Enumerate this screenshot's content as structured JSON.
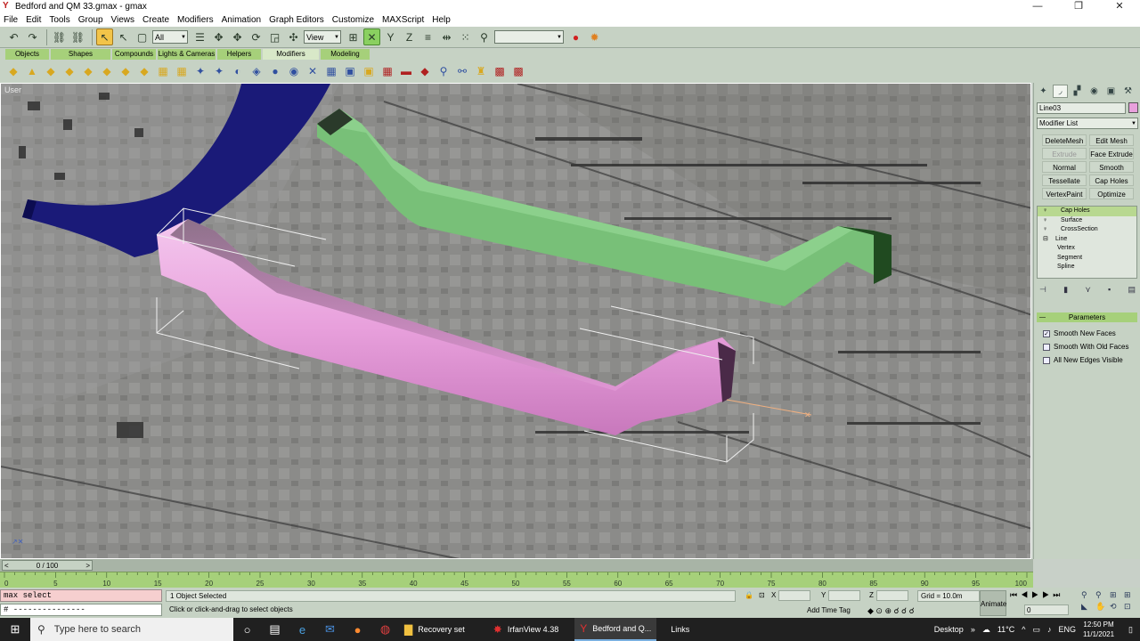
{
  "window": {
    "title": "Bedford and QM 33.gmax - gmax",
    "min": "—",
    "max": "❐",
    "close": "✕"
  },
  "menu": [
    "File",
    "Edit",
    "Tools",
    "Group",
    "Views",
    "Create",
    "Modifiers",
    "Animation",
    "Graph Editors",
    "Customize",
    "MAXScript",
    "Help"
  ],
  "toolbar": {
    "selection_filter": "All",
    "ref_coord": "View",
    "named_selection": ""
  },
  "tabs": [
    {
      "label": "Objects",
      "active": false
    },
    {
      "label": "Shapes",
      "active": false
    },
    {
      "label": "Compounds",
      "active": false
    },
    {
      "label": "Lights & Cameras",
      "active": false
    },
    {
      "label": "Helpers",
      "active": false
    },
    {
      "label": "Modifiers",
      "active": true
    },
    {
      "label": "Modeling",
      "active": false
    }
  ],
  "viewport": {
    "label": "User"
  },
  "command_panel": {
    "object_name": "Line03",
    "object_color": "#e8a0dc",
    "modifier_list": "Modifier List",
    "modifier_buttons": [
      {
        "label": "DeleteMesh",
        "enabled": true
      },
      {
        "label": "Edit Mesh",
        "enabled": true
      },
      {
        "label": "Extrude",
        "enabled": false
      },
      {
        "label": "Face Extrude",
        "enabled": true
      },
      {
        "label": "Normal",
        "enabled": true
      },
      {
        "label": "Smooth",
        "enabled": true
      },
      {
        "label": "Tessellate",
        "enabled": true
      },
      {
        "label": "Cap Holes",
        "enabled": true
      },
      {
        "label": "VertexPaint",
        "enabled": true
      },
      {
        "label": "Optimize",
        "enabled": true
      }
    ],
    "stack": [
      {
        "label": "Cap Holes",
        "indent": 1,
        "bulb": true,
        "selected": true
      },
      {
        "label": "Surface",
        "indent": 1,
        "bulb": true,
        "selected": false
      },
      {
        "label": "CrossSection",
        "indent": 1,
        "bulb": true,
        "selected": false
      },
      {
        "label": "Line",
        "indent": 0,
        "bulb": false,
        "selected": false,
        "expander": "⊟"
      },
      {
        "label": "Vertex",
        "indent": 2,
        "bulb": false,
        "selected": false
      },
      {
        "label": "Segment",
        "indent": 2,
        "bulb": false,
        "selected": false
      },
      {
        "label": "Spline",
        "indent": 2,
        "bulb": false,
        "selected": false
      }
    ],
    "rollout_title": "Parameters",
    "params": [
      {
        "label": "Smooth New Faces",
        "checked": true
      },
      {
        "label": "Smooth With Old Faces",
        "checked": false
      },
      {
        "label": "All New Edges Visible",
        "checked": false
      }
    ]
  },
  "timeline": {
    "slider_label": "0 / 100",
    "left_arrow": "<",
    "right_arrow": ">",
    "ticks": [
      0,
      5,
      10,
      15,
      20,
      25,
      30,
      35,
      40,
      45,
      50,
      55,
      60,
      65,
      70,
      75,
      80,
      85,
      90,
      95,
      100
    ]
  },
  "status": {
    "script_input": "max select",
    "script_output": "# ---------------",
    "selection_info": "1 Object Selected",
    "prompt": "Click or click-and-drag to select objects",
    "x_label": "X",
    "y_label": "Y",
    "z_label": "Z",
    "grid": "Grid = 10.0m",
    "add_time_tag": "Add Time Tag",
    "animate": "Animate",
    "frame": "0"
  },
  "taskbar": {
    "search_placeholder": "Type here to search",
    "apps": [
      {
        "label": "Recovery set",
        "running": false
      },
      {
        "label": "IrfanView 4.38",
        "running": false
      },
      {
        "label": "Bedford and Q...",
        "running": true
      },
      {
        "label": "Links",
        "running": false
      }
    ],
    "desktop": "Desktop",
    "temperature": "11°C",
    "lang": "ENG",
    "time": "12:50 PM",
    "date": "11/1/2021"
  }
}
